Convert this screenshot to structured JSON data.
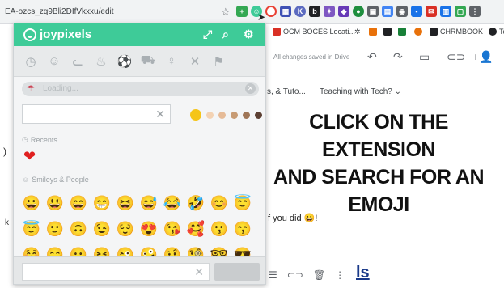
{
  "browser": {
    "url": "EA-ozcs_zq9Bli2DIfVkxxu/edit",
    "bookmarks": [
      {
        "label": "OCM BOCES Locati...",
        "color": "#d93025"
      },
      {
        "label": "CHRMBOOK",
        "color": "#202124"
      },
      {
        "label": "Te",
        "color": "#202124"
      }
    ]
  },
  "joypixels": {
    "brand": "joypixels",
    "loading_text": "Loading...",
    "search_value": "",
    "recents_label": "Recents",
    "smileys_label": "Smileys & People",
    "recent_emoji": "❤",
    "skin_tones": [
      "#f5c518",
      "#f3d2b3",
      "#e6bb97",
      "#c79b74",
      "#9f7657",
      "#5c4033"
    ],
    "footer_value": "",
    "emoji_rows": [
      [
        "😀",
        "😃",
        "😄",
        "😁",
        "😆",
        "😅",
        "😂",
        "🤣",
        "😊",
        "😇"
      ],
      [
        "😇",
        "🙂",
        "🙃",
        "😉",
        "😌",
        "😍",
        "😘",
        "🥰",
        "😗",
        "😙"
      ],
      [
        "😚",
        "😋",
        "😛",
        "😝",
        "😜",
        "🤪",
        "🤨",
        "🧐",
        "🤓",
        "😎"
      ]
    ]
  },
  "docs": {
    "saved_status": "All changes saved in Drive",
    "breadcrumb": "s, & Tuto...",
    "teaching": "Teaching with Tech?",
    "doc_line": "f you did 😀!",
    "left_text": "k",
    "bottom_ls": "ls"
  },
  "overlay": {
    "line1": "CLICK ON THE EXTENSION",
    "line2": "AND SEARCH FOR AN EMOJI"
  }
}
